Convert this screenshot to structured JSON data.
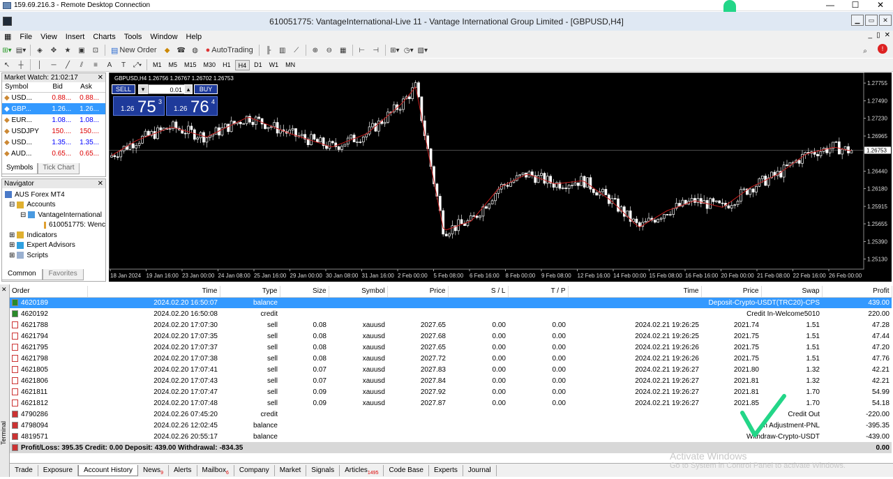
{
  "rdp": {
    "title": "159.69.216.3 - Remote Desktop Connection",
    "min": "—",
    "max": "☐",
    "close": "✕"
  },
  "app": {
    "title": "610051775: VantageInternational-Live 11 - Vantage International Group Limited - [GBPUSD,H4]"
  },
  "menu": [
    "File",
    "View",
    "Insert",
    "Charts",
    "Tools",
    "Window",
    "Help"
  ],
  "toolbar": {
    "new_order": "New Order",
    "autotrading": "AutoTrading"
  },
  "timeframes": [
    "M1",
    "M5",
    "M15",
    "M30",
    "H1",
    "H4",
    "D1",
    "W1",
    "MN"
  ],
  "active_timeframe": "H4",
  "market_watch": {
    "title": "Market Watch: 21:02:17",
    "cols": [
      "Symbol",
      "Bid",
      "Ask"
    ],
    "rows": [
      {
        "sym": "USD...",
        "bid": "0.88...",
        "ask": "0.88...",
        "c": "red"
      },
      {
        "sym": "GBP...",
        "bid": "1.26...",
        "ask": "1.26...",
        "c": "sel"
      },
      {
        "sym": "EUR...",
        "bid": "1.08...",
        "ask": "1.08...",
        "c": "bl"
      },
      {
        "sym": "USDJPY",
        "bid": "150....",
        "ask": "150....",
        "c": "red"
      },
      {
        "sym": "USD...",
        "bid": "1.35...",
        "ask": "1.35...",
        "c": "bl"
      },
      {
        "sym": "AUD...",
        "bid": "0.65...",
        "ask": "0.65...",
        "c": "red"
      }
    ],
    "tabs": [
      "Symbols",
      "Tick Chart"
    ]
  },
  "navigator": {
    "title": "Navigator",
    "items": [
      "AUS Forex MT4",
      "Accounts",
      "VantageInternational",
      "610051775: Wenc",
      "Indicators",
      "Expert Advisors",
      "Scripts"
    ],
    "tabs": [
      "Common",
      "Favorites"
    ]
  },
  "chart": {
    "ohlc": "GBPUSD,H4  1.26756 1.26767 1.26702 1.26753",
    "sell": "SELL",
    "buy": "BUY",
    "lot": "0.01",
    "bid_small": "1.26",
    "bid_big": "75",
    "bid_sup": "3",
    "ask_small": "1.26",
    "ask_big": "76",
    "ask_sup": "4",
    "price_axis": [
      "1.27755",
      "1.27490",
      "1.27230",
      "1.26965",
      "1.26753",
      "1.26440",
      "1.26180",
      "1.25915",
      "1.25655",
      "1.25390",
      "1.25130"
    ],
    "time_axis": [
      "18 Jan 2024",
      "19 Jan 16:00",
      "23 Jan 00:00",
      "24 Jan 08:00",
      "25 Jan 16:00",
      "29 Jan 00:00",
      "30 Jan 08:00",
      "31 Jan 16:00",
      "2 Feb 00:00",
      "5 Feb 08:00",
      "6 Feb 16:00",
      "8 Feb 00:00",
      "9 Feb 08:00",
      "12 Feb 16:00",
      "14 Feb 00:00",
      "15 Feb 08:00",
      "16 Feb 16:00",
      "20 Feb 00:00",
      "21 Feb 08:00",
      "22 Feb 16:00",
      "26 Feb 00:00"
    ]
  },
  "history": {
    "cols": [
      "Order",
      "Time",
      "Type",
      "Size",
      "Symbol",
      "Price",
      "S / L",
      "T / P",
      "Time",
      "Price",
      "Swap",
      "Profit"
    ],
    "rows": [
      {
        "o": "4620189",
        "t": "2024.02.20 16:50:07",
        "ty": "balance",
        "cm": "Deposit-Crypto-USDT(TRC20)-CPS",
        "p": "439.00",
        "ic": "bal",
        "sel": true
      },
      {
        "o": "4620192",
        "t": "2024.02.20 16:50:08",
        "ty": "credit",
        "cm": "Credit In-Welcome5010",
        "p": "220.00",
        "ic": "bal"
      },
      {
        "o": "4621788",
        "t": "2024.02.20 17:07:30",
        "ty": "sell",
        "sz": "0.08",
        "sy": "xauusd",
        "pr": "2027.65",
        "sl": "0.00",
        "tp": "0.00",
        "ct": "2024.02.21 19:26:25",
        "cp": "2021.74",
        "sw": "1.51",
        "p": "47.28",
        "ic": "sell"
      },
      {
        "o": "4621794",
        "t": "2024.02.20 17:07:35",
        "ty": "sell",
        "sz": "0.08",
        "sy": "xauusd",
        "pr": "2027.68",
        "sl": "0.00",
        "tp": "0.00",
        "ct": "2024.02.21 19:26:25",
        "cp": "2021.75",
        "sw": "1.51",
        "p": "47.44",
        "ic": "sell"
      },
      {
        "o": "4621795",
        "t": "2024.02.20 17:07:37",
        "ty": "sell",
        "sz": "0.08",
        "sy": "xauusd",
        "pr": "2027.65",
        "sl": "0.00",
        "tp": "0.00",
        "ct": "2024.02.21 19:26:26",
        "cp": "2021.75",
        "sw": "1.51",
        "p": "47.20",
        "ic": "sell"
      },
      {
        "o": "4621798",
        "t": "2024.02.20 17:07:38",
        "ty": "sell",
        "sz": "0.08",
        "sy": "xauusd",
        "pr": "2027.72",
        "sl": "0.00",
        "tp": "0.00",
        "ct": "2024.02.21 19:26:26",
        "cp": "2021.75",
        "sw": "1.51",
        "p": "47.76",
        "ic": "sell"
      },
      {
        "o": "4621805",
        "t": "2024.02.20 17:07:41",
        "ty": "sell",
        "sz": "0.07",
        "sy": "xauusd",
        "pr": "2027.83",
        "sl": "0.00",
        "tp": "0.00",
        "ct": "2024.02.21 19:26:27",
        "cp": "2021.80",
        "sw": "1.32",
        "p": "42.21",
        "ic": "sell"
      },
      {
        "o": "4621806",
        "t": "2024.02.20 17:07:43",
        "ty": "sell",
        "sz": "0.07",
        "sy": "xauusd",
        "pr": "2027.84",
        "sl": "0.00",
        "tp": "0.00",
        "ct": "2024.02.21 19:26:27",
        "cp": "2021.81",
        "sw": "1.32",
        "p": "42.21",
        "ic": "sell"
      },
      {
        "o": "4621811",
        "t": "2024.02.20 17:07:47",
        "ty": "sell",
        "sz": "0.09",
        "sy": "xauusd",
        "pr": "2027.92",
        "sl": "0.00",
        "tp": "0.00",
        "ct": "2024.02.21 19:26:27",
        "cp": "2021.81",
        "sw": "1.70",
        "p": "54.99",
        "ic": "sell"
      },
      {
        "o": "4621812",
        "t": "2024.02.20 17:07:48",
        "ty": "sell",
        "sz": "0.09",
        "sy": "xauusd",
        "pr": "2027.87",
        "sl": "0.00",
        "tp": "0.00",
        "ct": "2024.02.21 19:26:27",
        "cp": "2021.85",
        "sw": "1.70",
        "p": "54.18",
        "ic": "sell"
      },
      {
        "o": "4790286",
        "t": "2024.02.26 07:45:20",
        "ty": "credit",
        "cm": "Credit Out",
        "p": "-220.00",
        "ic": "cred"
      },
      {
        "o": "4798094",
        "t": "2024.02.26 12:02:45",
        "ty": "balance",
        "cm": "h Adjustment-PNL",
        "p": "-395.35",
        "ic": "cred"
      },
      {
        "o": "4819571",
        "t": "2024.02.26 20:55:17",
        "ty": "balance",
        "cm": "Withdraw-Crypto-USDT",
        "p": "-439.00",
        "ic": "cred"
      }
    ],
    "summary": "Profit/Loss: 395.35  Credit: 0.00  Deposit: 439.00  Withdrawal: -834.35",
    "summary_total": "0.00"
  },
  "terminal_label": "Terminal",
  "bottom_tabs": [
    {
      "l": "Trade"
    },
    {
      "l": "Exposure"
    },
    {
      "l": "Account History",
      "act": true
    },
    {
      "l": "News",
      "b": "9"
    },
    {
      "l": "Alerts"
    },
    {
      "l": "Mailbox",
      "b": "6"
    },
    {
      "l": "Company"
    },
    {
      "l": "Market"
    },
    {
      "l": "Signals"
    },
    {
      "l": "Articles",
      "b": "1495"
    },
    {
      "l": "Code Base"
    },
    {
      "l": "Experts"
    },
    {
      "l": "Journal"
    }
  ],
  "activate": {
    "line1": "Activate Windows",
    "line2": "Go to System in Control Panel to activate Windows."
  },
  "colors": {
    "bull": "#ffffff",
    "bear": "#ffffff",
    "ma": "#c81e1e",
    "grid": "#1a1a1a",
    "selection": "#3399ff",
    "accent_mark": "#23d688"
  }
}
